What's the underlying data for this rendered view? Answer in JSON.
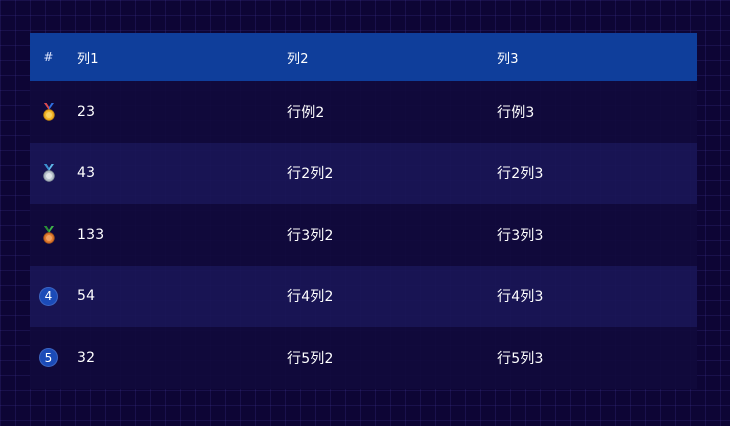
{
  "table": {
    "headers": [
      "#",
      "列1",
      "列2",
      "列3"
    ],
    "rows": [
      {
        "rank": "1",
        "medal": "gold-medal-icon",
        "medal_color": "#f2b52a",
        "col1": "23",
        "col2": "行例2",
        "col3": "行例3"
      },
      {
        "rank": "2",
        "medal": "silver-medal-icon",
        "medal_color": "#b9c3cc",
        "col1": "43",
        "col2": "行2列2",
        "col3": "行2列3"
      },
      {
        "rank": "3",
        "medal": "bronze-medal-icon",
        "medal_color": "#e07a2e",
        "col1": "133",
        "col2": "行3列2",
        "col3": "行3列3"
      },
      {
        "rank": "4",
        "col1": "54",
        "col2": "行4列2",
        "col3": "行4列3"
      },
      {
        "rank": "5",
        "col1": "32",
        "col2": "行5列2",
        "col3": "行5列3"
      }
    ]
  },
  "colors": {
    "header_bg": "#0f3e9b",
    "page_bg": "#0d0535",
    "row_odd": "#110a3c",
    "row_even": "#1a1656",
    "rank_badge": "#1b4bb8"
  }
}
